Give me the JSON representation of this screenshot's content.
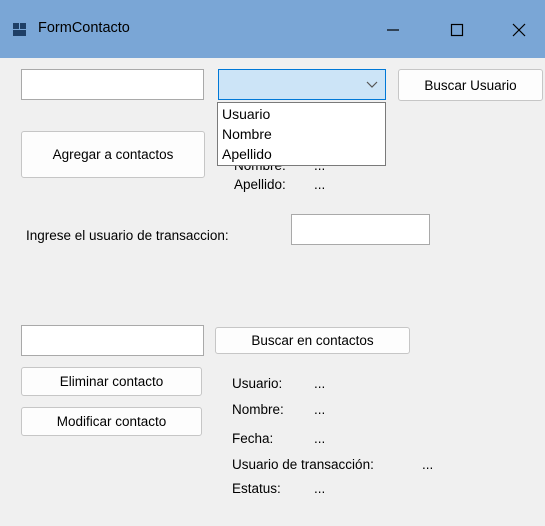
{
  "window": {
    "title": "FormContacto",
    "icon": "app-form-icon",
    "controls": [
      "minimize-icon",
      "maximize-icon",
      "close-icon"
    ]
  },
  "search": {
    "input_value": "",
    "combo_value": "",
    "combo_options": [
      "Usuario",
      "Nombre",
      "Apellido"
    ],
    "button_label": "Buscar Usuario"
  },
  "add_button_label": "Agregar a contactos",
  "user_info": {
    "nombre_label": "Nombre:",
    "nombre_value": "...",
    "apellido_label": "Apellido:",
    "apellido_value": "..."
  },
  "transaction": {
    "label": "Ingrese el usuario de transaccion:",
    "input_value": ""
  },
  "contacts": {
    "search_input_value": "",
    "search_button_label": "Buscar en contactos",
    "delete_button_label": "Eliminar contacto",
    "modify_button_label": "Modificar contacto"
  },
  "details": {
    "usuario_label": "Usuario:",
    "usuario_value": "...",
    "nombre_label": "Nombre:",
    "nombre_value": "...",
    "fecha_label": "Fecha:",
    "fecha_value": "...",
    "usuario_trans_label": "Usuario de transacción:",
    "usuario_trans_value": "...",
    "estatus_label": "Estatus:",
    "estatus_value": "..."
  },
  "colors": {
    "titlebar": "#7aa6d6",
    "window_bg": "#f0f0f0",
    "combo_focus_bg": "#cce4f7",
    "combo_focus_border": "#0078d7"
  }
}
